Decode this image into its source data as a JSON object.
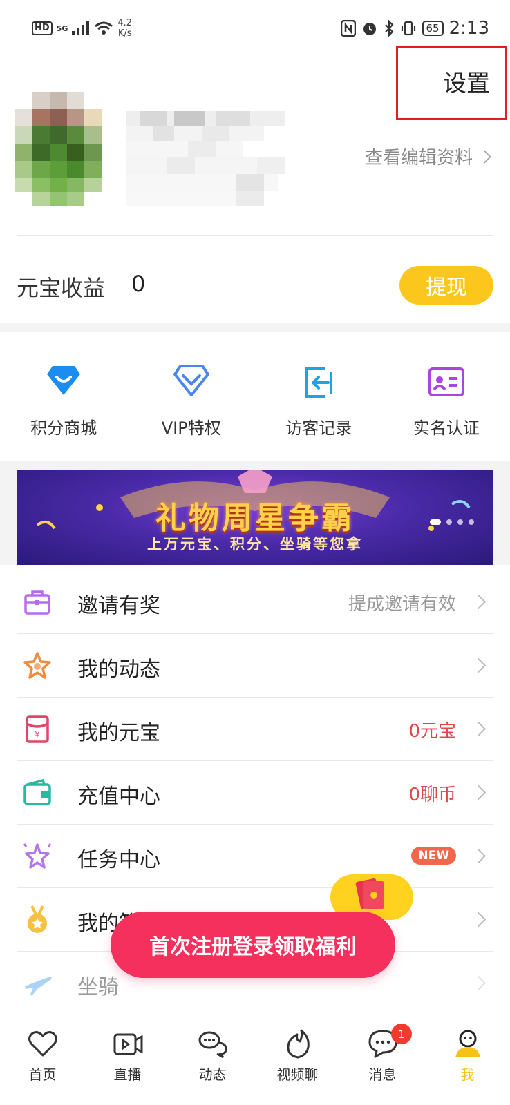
{
  "status_bar": {
    "hd": "HD",
    "network": "5G",
    "speed_value": "4.2",
    "speed_unit": "K/s",
    "battery": "65",
    "time": "2:13"
  },
  "header": {
    "settings_label": "设置",
    "edit_profile_label": "查看编辑资料"
  },
  "earnings": {
    "label": "元宝收益",
    "value": "0",
    "withdraw_label": "提现"
  },
  "quick_links": [
    {
      "label": "积分商城",
      "icon": "shopping-bag-icon",
      "color": "#1b8cf0"
    },
    {
      "label": "VIP特权",
      "icon": "diamond-icon",
      "color": "#4a86f0"
    },
    {
      "label": "访客记录",
      "icon": "visitor-enter-icon",
      "color": "#20a3e6"
    },
    {
      "label": "实名认证",
      "icon": "id-card-icon",
      "color": "#a747e0"
    }
  ],
  "banner": {
    "title": "礼物周星争霸",
    "subtitle": "上万元宝、积分、坐骑等您拿"
  },
  "menu": [
    {
      "label": "邀请有奖",
      "right": "提成邀请有效",
      "icon": "briefcase-icon",
      "color": "#b56bf0"
    },
    {
      "label": "我的动态",
      "right": "",
      "icon": "star-icon",
      "color": "#f08a3c"
    },
    {
      "label": "我的元宝",
      "right": "0元宝",
      "icon": "red-envelope-icon",
      "color": "#e0456a"
    },
    {
      "label": "充值中心",
      "right": "0聊币",
      "icon": "wallet-icon",
      "color": "#29b9a0"
    },
    {
      "label": "任务中心",
      "right": "NEW",
      "icon": "sparkle-star-icon",
      "color": "#b275f0"
    },
    {
      "label": "我的等级",
      "right": "",
      "icon": "medal-icon",
      "color": "#f5c144"
    },
    {
      "label": "坐骑",
      "right": "",
      "icon": "plane-icon",
      "color": "#4a9cf0"
    }
  ],
  "promo": {
    "label": "首次注册登录领取福利"
  },
  "tabbar": [
    {
      "label": "首页",
      "icon": "heart-icon"
    },
    {
      "label": "直播",
      "icon": "video-camera-icon"
    },
    {
      "label": "动态",
      "icon": "chat-bubbles-icon"
    },
    {
      "label": "视频聊",
      "icon": "flame-icon"
    },
    {
      "label": "消息",
      "icon": "message-icon",
      "badge": "1"
    },
    {
      "label": "我",
      "icon": "user-icon"
    }
  ],
  "colors": {
    "accent_yellow": "#fcc71d",
    "promo_pink": "#f5305c",
    "highlight_red": "#e0201e"
  }
}
